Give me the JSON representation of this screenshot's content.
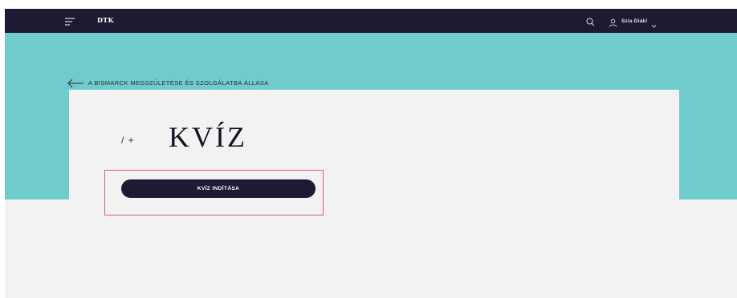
{
  "header": {
    "brand": "DTK",
    "user_name": "Szia Diák!",
    "icons": {
      "menu": "hamburger-menu-icon",
      "search": "search-icon",
      "user": "user-icon",
      "dropdown": "chevron-down-icon"
    }
  },
  "breadcrumb": {
    "back_label": "A BISMARCK MEGSZÜLETÉSE ÉS SZOLGÁLATBA ÁLLÁSA"
  },
  "quiz": {
    "counter": "/ +",
    "title": "KVÍZ",
    "start_button_label": "KVÍZ INDÍTÁSA"
  },
  "colors": {
    "topbar": "#1d1b33",
    "hero": "#6fcbcc",
    "card": "#f2f2f2",
    "highlight": "#e0587a"
  }
}
